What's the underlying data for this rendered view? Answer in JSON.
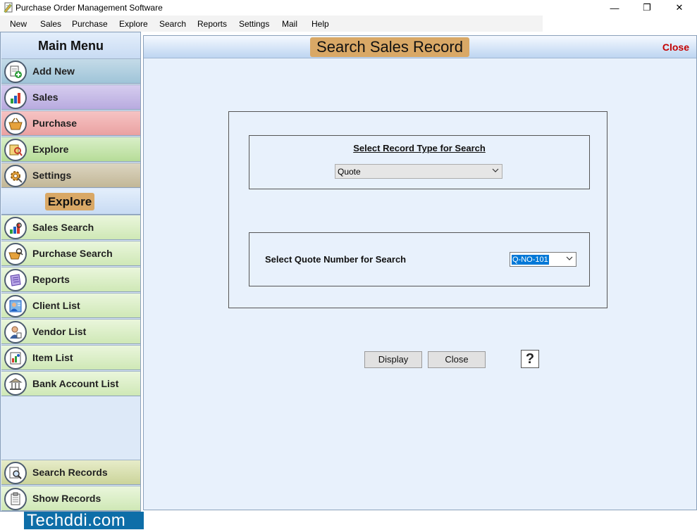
{
  "window": {
    "title": "Purchase Order Management Software",
    "controls": {
      "minimize": "—",
      "maximize": "❐",
      "close": "✕"
    }
  },
  "menubar": [
    "New",
    "Sales",
    "Purchase",
    "Explore",
    "Search",
    "Reports",
    "Settings",
    "Mail",
    "Help"
  ],
  "sidebar": {
    "main_menu_title": "Main Menu",
    "main_items": [
      {
        "label": "Add New",
        "icon": "add-document-icon"
      },
      {
        "label": "Sales",
        "icon": "bar-chart-icon"
      },
      {
        "label": "Purchase",
        "icon": "basket-icon"
      },
      {
        "label": "Explore",
        "icon": "explore-icon"
      },
      {
        "label": "Settings",
        "icon": "settings-gear-icon"
      }
    ],
    "explore_title": "Explore",
    "explore_items": [
      {
        "label": "Sales Search",
        "icon": "sales-search-icon"
      },
      {
        "label": "Purchase Search",
        "icon": "purchase-search-icon"
      },
      {
        "label": "Reports",
        "icon": "reports-icon"
      },
      {
        "label": "Client List",
        "icon": "client-list-icon"
      },
      {
        "label": "Vendor List",
        "icon": "vendor-list-icon"
      },
      {
        "label": "Item List",
        "icon": "item-list-icon"
      },
      {
        "label": "Bank Account List",
        "icon": "bank-icon"
      }
    ],
    "bottom_items": [
      {
        "label": "Search Records",
        "icon": "search-records-icon"
      },
      {
        "label": "Show Records",
        "icon": "show-records-icon"
      }
    ]
  },
  "main": {
    "title": "Search Sales Record",
    "close_link": "Close",
    "record_type_title": "Select Record Type for Search",
    "record_type_selected": "Quote",
    "quote_label": "Select Quote Number for Search",
    "quote_selected": "Q-NO-101",
    "display_button": "Display",
    "close_button": "Close",
    "help_button": "?"
  },
  "watermark": "Techddi.com",
  "colors": {
    "title_tag": "#d9a866",
    "close_link": "#c40000",
    "selection": "#0078d7",
    "watermark_bg": "#0e6ea8"
  }
}
